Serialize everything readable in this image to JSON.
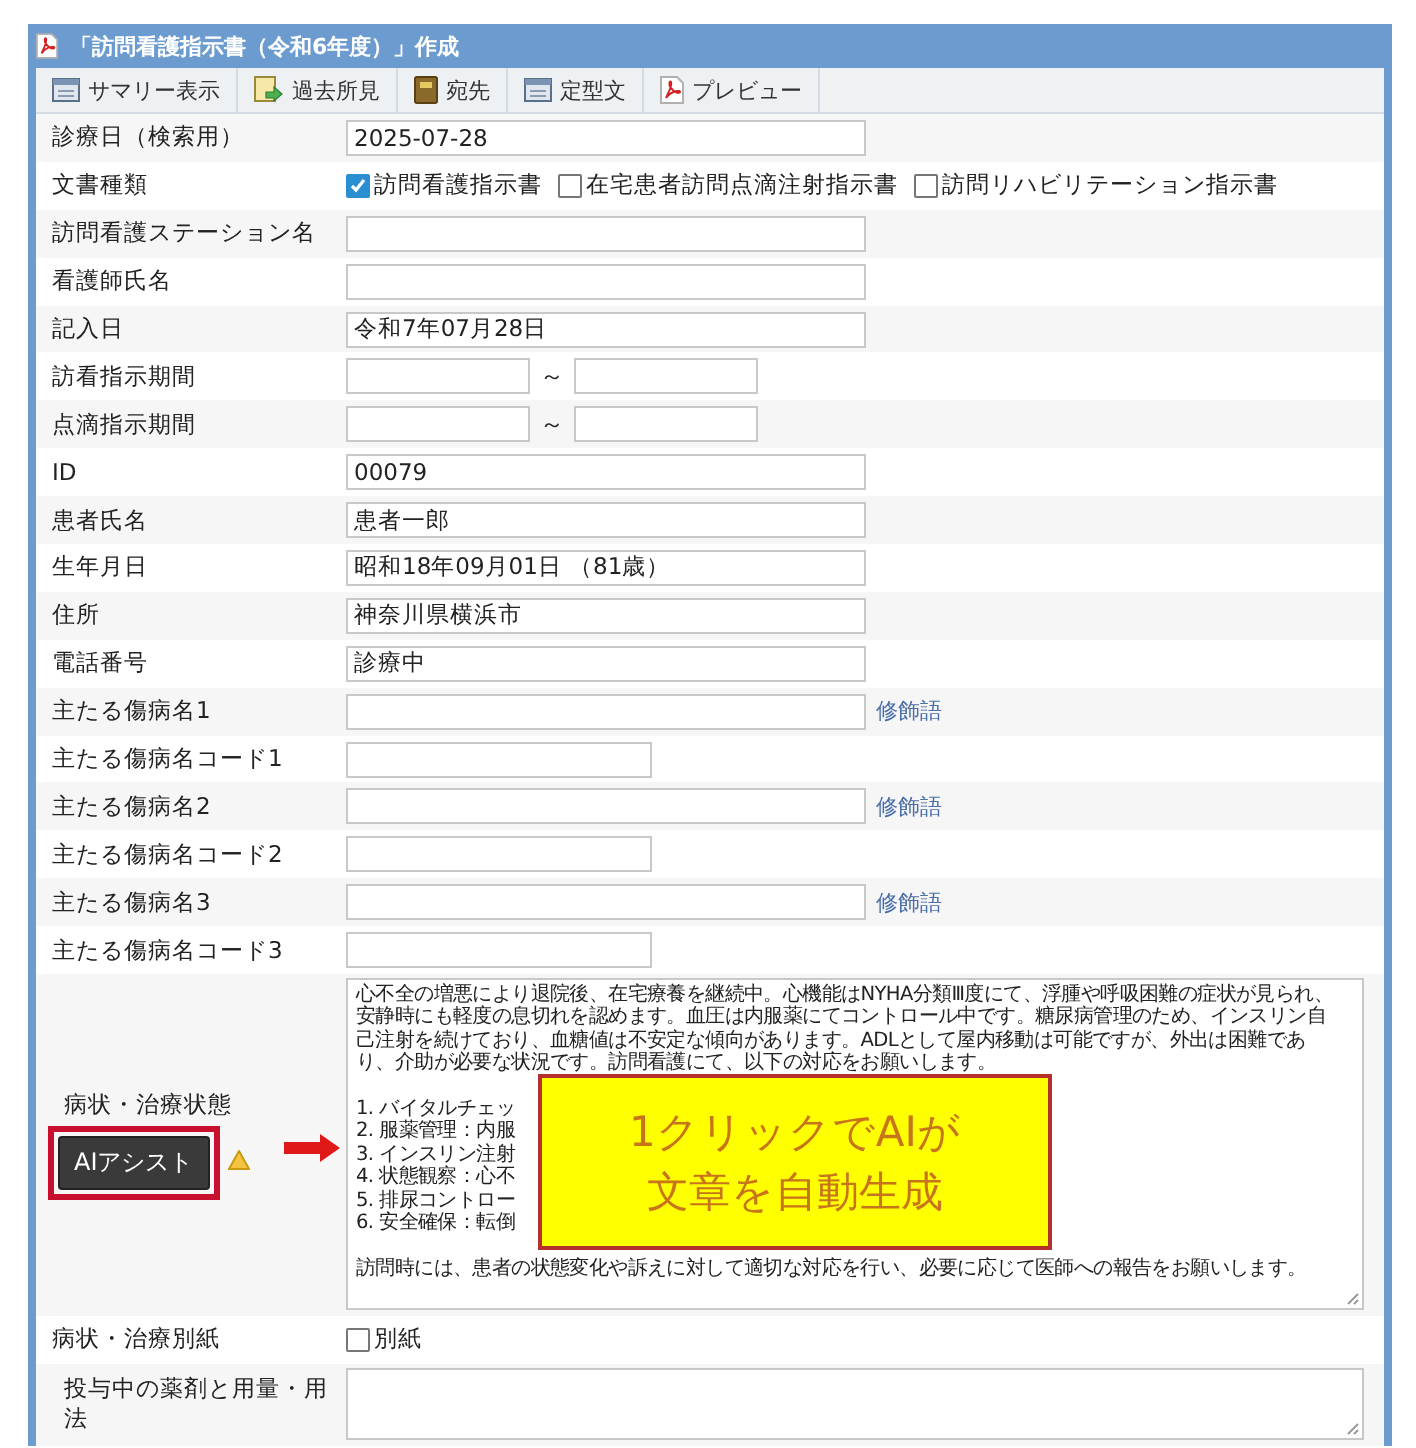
{
  "window": {
    "title": "「訪問看護指示書（令和6年度）」作成"
  },
  "toolbar": [
    {
      "label": "サマリー表示",
      "kind": "window"
    },
    {
      "label": "過去所見",
      "kind": "import"
    },
    {
      "label": "宛先",
      "kind": "book"
    },
    {
      "label": "定型文",
      "kind": "window"
    },
    {
      "label": "プレビュー",
      "kind": "pdf"
    }
  ],
  "form": {
    "rows": [
      {
        "label": "診療日（検索用）",
        "kind": "text",
        "value": "2025-07-28"
      },
      {
        "label": "文書種類",
        "kind": "checkboxes",
        "options": [
          {
            "label": "訪問看護指示書",
            "checked": true
          },
          {
            "label": "在宅患者訪問点滴注射指示書",
            "checked": false
          },
          {
            "label": "訪問リハビリテーション指示書",
            "checked": false
          }
        ]
      },
      {
        "label": "訪問看護ステーション名",
        "kind": "text"
      },
      {
        "label": "看護師氏名",
        "kind": "text"
      },
      {
        "label": "記入日",
        "kind": "text",
        "value": "令和7年07月28日"
      },
      {
        "label": "訪看指示期間",
        "kind": "range",
        "separator": "～"
      },
      {
        "label": "点滴指示期間",
        "kind": "range",
        "separator": "～"
      },
      {
        "label": "ID",
        "kind": "text",
        "value": "00079"
      },
      {
        "label": "患者氏名",
        "kind": "text",
        "value": "患者一郎"
      },
      {
        "label": "生年月日",
        "kind": "text",
        "value": "昭和18年09月01日 （81歳）"
      },
      {
        "label": "住所",
        "kind": "text",
        "value": "神奈川県横浜市"
      },
      {
        "label": "電話番号",
        "kind": "text",
        "value": "診療中"
      },
      {
        "label": "主たる傷病名1",
        "kind": "text",
        "link": "修飾語"
      },
      {
        "label": "主たる傷病名コード1",
        "kind": "code"
      },
      {
        "label": "主たる傷病名2",
        "kind": "text",
        "link": "修飾語"
      },
      {
        "label": "主たる傷病名コード2",
        "kind": "code"
      },
      {
        "label": "主たる傷病名3",
        "kind": "text",
        "link": "修飾語"
      },
      {
        "label": "主たる傷病名コード3",
        "kind": "code"
      },
      {
        "label": "病状・治療状態",
        "kind": "textarea",
        "button": "AIアシスト",
        "paragraphs": [
          {
            "kind": "para",
            "text": "心不全の増悪により退院後、在宅療養を継続中。心機能はNYHA分類Ⅲ度にて、浮腫や呼吸困難の症状が見られ、安静時にも軽度の息切れを認めます。血圧は内服薬にてコントロール中です。糖尿病管理のため、インスリン自己注射を続けており、血糖値は不安定な傾向があります。ADLとして屋内移動は可能ですが、外出は困難であり、介助が必要な状況です。訪問看護にて、以下の対応をお願いします。"
          },
          {
            "kind": "item",
            "text": "1.  バイタルチェッ"
          },
          {
            "kind": "item",
            "text": "2.  服薬管理：内服"
          },
          {
            "kind": "item",
            "text": "3.  インスリン注射"
          },
          {
            "kind": "item",
            "text": "4.  状態観察：心不"
          },
          {
            "kind": "item",
            "text": "5.  排尿コントロー"
          },
          {
            "kind": "item",
            "text": "6.  安全確保：転倒"
          },
          {
            "kind": "para",
            "text": "訪問時には、患者の状態変化や訴えに対して適切な対応を行い、必要に応じて医師への報告をお願いします。"
          }
        ]
      },
      {
        "label": "病状・治療別紙",
        "kind": "checkboxes",
        "options": [
          {
            "label": "別紙",
            "checked": false
          }
        ]
      },
      {
        "label": "投与中の薬剤と用量・用法",
        "kind": "textarea"
      }
    ]
  },
  "callout": {
    "lines": [
      "1クリックでAIが",
      "文章を自動生成"
    ]
  }
}
